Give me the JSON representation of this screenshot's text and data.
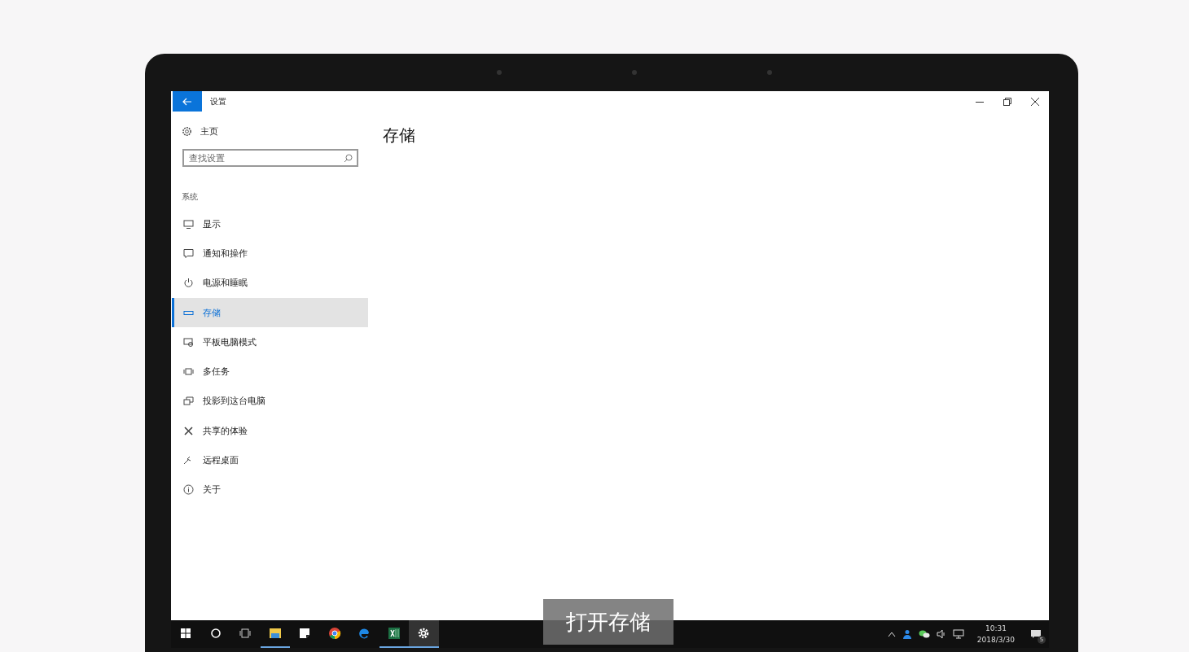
{
  "window": {
    "title": "设置"
  },
  "sidebar": {
    "home": "主页",
    "search": {
      "placeholder": "查找设置"
    },
    "section": "系统",
    "items": [
      {
        "label": "显示",
        "kind": "display",
        "selected": false
      },
      {
        "label": "通知和操作",
        "kind": "notify",
        "selected": false
      },
      {
        "label": "电源和睡眠",
        "kind": "power",
        "selected": false
      },
      {
        "label": "存储",
        "kind": "storage",
        "selected": true
      },
      {
        "label": "平板电脑模式",
        "kind": "tablet",
        "selected": false
      },
      {
        "label": "多任务",
        "kind": "multitask",
        "selected": false
      },
      {
        "label": "投影到这台电脑",
        "kind": "project",
        "selected": false
      },
      {
        "label": "共享的体验",
        "kind": "share",
        "selected": false
      },
      {
        "label": "远程桌面",
        "kind": "remote",
        "selected": false
      },
      {
        "label": "关于",
        "kind": "about",
        "selected": false
      }
    ]
  },
  "page": {
    "title": "存储"
  },
  "taskbar": {
    "apps": [
      {
        "kind": "start",
        "running": false,
        "selected": false
      },
      {
        "kind": "search",
        "running": false,
        "selected": false
      },
      {
        "kind": "taskview",
        "running": false,
        "selected": false
      },
      {
        "kind": "folder",
        "running": true,
        "selected": false
      },
      {
        "kind": "notes",
        "running": false,
        "selected": false
      },
      {
        "kind": "chrome",
        "running": false,
        "selected": false
      },
      {
        "kind": "edge",
        "running": false,
        "selected": false
      },
      {
        "kind": "excel",
        "running": true,
        "selected": false
      },
      {
        "kind": "settings",
        "running": true,
        "selected": true
      }
    ],
    "time": "10:31",
    "date": "2018/3/30",
    "notifications": "5"
  },
  "caption": "打开存储"
}
